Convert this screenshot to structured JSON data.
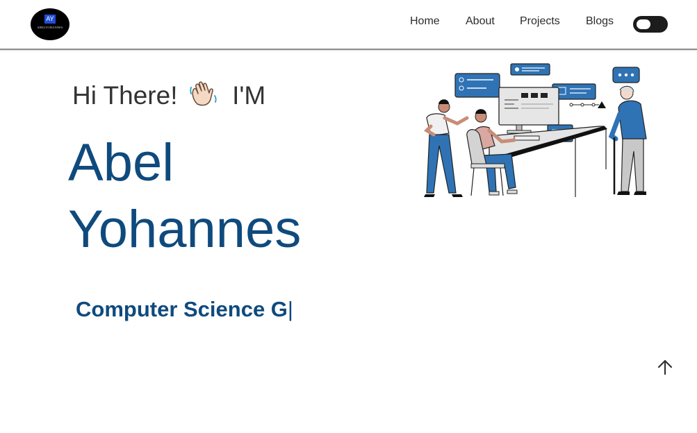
{
  "navbar": {
    "logo": {
      "mark": "AY",
      "text": "ABELYOHANNES"
    },
    "links": [
      {
        "label": "Home"
      },
      {
        "label": "About"
      },
      {
        "label": "Projects"
      },
      {
        "label": "Blogs"
      }
    ],
    "theme_toggle": {
      "state": "off"
    }
  },
  "hero": {
    "greeting_before": "Hi There!",
    "greeting_emoji": "waving-hand-icon",
    "greeting_after": "I'M",
    "name_first": "Abel",
    "name_last": "Yohannes",
    "typed_text": "Computer Science G",
    "typed_cursor": "|"
  },
  "colors": {
    "accent": "#0f4a7d",
    "text": "#333333",
    "nav_border": "#8c8c8c",
    "toggle_bg": "#1c1c1c",
    "illustration_blue": "#2f73b5"
  },
  "icons": {
    "scroll_top": "arrow-up-icon",
    "illustration": "developers-at-workstation-illustration"
  }
}
